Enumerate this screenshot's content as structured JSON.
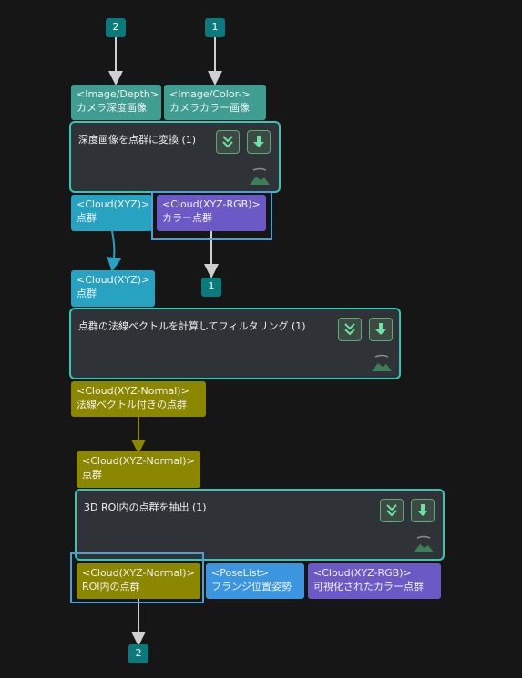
{
  "badges": {
    "in_depth": "2",
    "in_color": "1",
    "out_rgb": "1",
    "out_roi": "2"
  },
  "node1": {
    "title": "深度画像を点群に変換 (1)",
    "inputs": [
      {
        "type": "<Image/Depth>",
        "name": "カメラ深度画像"
      },
      {
        "type": "<Image/Color->",
        "name": "カメラカラー画像"
      }
    ],
    "outputs": [
      {
        "type": "<Cloud(XYZ)>",
        "name": "点群"
      },
      {
        "type": "<Cloud(XYZ-RGB)>",
        "name": "カラー点群"
      }
    ]
  },
  "node2": {
    "title": "点群の法線ベクトルを計算してフィルタリング (1)",
    "inputs": [
      {
        "type": "<Cloud(XYZ)>",
        "name": "点群"
      }
    ],
    "outputs": [
      {
        "type": "<Cloud(XYZ-Normal)>",
        "name": "法線ベクトル付きの点群"
      }
    ]
  },
  "node3": {
    "title": "3D ROI内の点群を抽出 (1)",
    "inputs": [
      {
        "type": "<Cloud(XYZ-Normal)>",
        "name": "点群"
      }
    ],
    "outputs": [
      {
        "type": "<Cloud(XYZ-Normal)>",
        "name": "ROI内の点群"
      },
      {
        "type": "<PoseList>",
        "name": "フランジ位置姿勢"
      },
      {
        "type": "<Cloud(XYZ-RGB)>",
        "name": "可視化されたカラー点群"
      }
    ]
  },
  "colors": {
    "background": "#161616",
    "node_border": "#32c8b8",
    "node_fill": "#2f3338",
    "port_image": "#3f9d92",
    "port_cloud_xyz": "#27a2c1",
    "port_cloud_rgb": "#6b59c6",
    "port_cloud_normal": "#8c8700",
    "port_poselist": "#3c96df",
    "badge": "#0b7a7c",
    "selection": "#4f9fd0"
  },
  "icons": [
    "collapse-chevron-icon",
    "download-arrow-icon",
    "visualize-preview-icon"
  ]
}
